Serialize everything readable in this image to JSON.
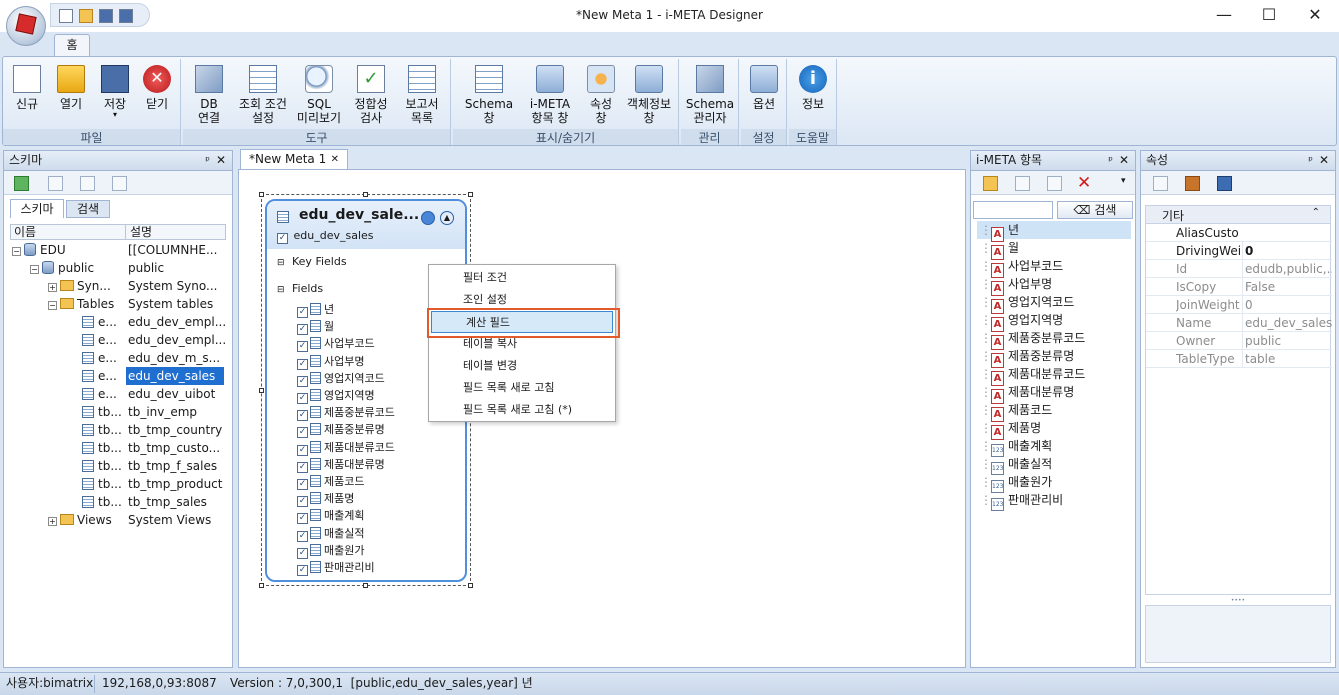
{
  "window": {
    "title": "*New Meta 1 - i-META Designer",
    "minimize": "—",
    "maximize": "☐",
    "close": "✕"
  },
  "ribbon": {
    "tab": "홈",
    "groups": [
      {
        "label": "파일",
        "buttons": [
          {
            "label": "신규",
            "icon": "new-doc-icon"
          },
          {
            "label": "열기",
            "icon": "open-folder-icon"
          },
          {
            "label": "저장",
            "icon": "save-icon",
            "sub": "▾"
          },
          {
            "label": "닫기",
            "icon": "close-doc-icon"
          }
        ]
      },
      {
        "label": "도구",
        "buttons": [
          {
            "label": "DB\n연결",
            "icon": "db-connect-icon"
          },
          {
            "label": "조회 조건\n설정",
            "icon": "filter-icon"
          },
          {
            "label": "SQL\n미리보기",
            "icon": "sql-preview-icon"
          },
          {
            "label": "정합성\n검사",
            "icon": "validate-icon"
          },
          {
            "label": "보고서\n목록",
            "icon": "report-list-icon"
          }
        ]
      },
      {
        "label": "표시/숨기기",
        "buttons": [
          {
            "label": "Schema\n창",
            "icon": "schema-window-icon"
          },
          {
            "label": "i-META\n항목 창",
            "icon": "imeta-window-icon"
          },
          {
            "label": "속성\n창",
            "icon": "property-window-icon"
          },
          {
            "label": "객체정보\n창",
            "icon": "object-info-icon"
          }
        ]
      },
      {
        "label": "관리",
        "buttons": [
          {
            "label": "Schema\n관리자",
            "icon": "schema-manager-icon"
          }
        ]
      },
      {
        "label": "설정",
        "buttons": [
          {
            "label": "옵션",
            "icon": "options-icon"
          }
        ]
      },
      {
        "label": "도움말",
        "buttons": [
          {
            "label": "정보",
            "icon": "info-icon"
          }
        ]
      }
    ]
  },
  "schema_panel": {
    "title": "스키마",
    "pin": "ᵖ",
    "close": "✕",
    "tabs": [
      "스키마",
      "검색"
    ],
    "columns": [
      "이름",
      "설명"
    ],
    "rows": [
      {
        "name": "EDU",
        "desc": "[[COLUMNHE..."
      },
      {
        "name": "public",
        "desc": "public"
      },
      {
        "name": "Syn...",
        "desc": "System Syno..."
      },
      {
        "name": "Tables",
        "desc": "System tables"
      },
      {
        "name": "e...",
        "desc": "edu_dev_empl..."
      },
      {
        "name": "e...",
        "desc": "edu_dev_empl..."
      },
      {
        "name": "e...",
        "desc": "edu_dev_m_s..."
      },
      {
        "name": "e...",
        "desc": "edu_dev_sales"
      },
      {
        "name": "e...",
        "desc": "edu_dev_uibot"
      },
      {
        "name": "tb...",
        "desc": "tb_inv_emp"
      },
      {
        "name": "tb...",
        "desc": "tb_tmp_country"
      },
      {
        "name": "tb...",
        "desc": "tb_tmp_custo..."
      },
      {
        "name": "tb...",
        "desc": "tb_tmp_f_sales"
      },
      {
        "name": "tb...",
        "desc": "tb_tmp_product"
      },
      {
        "name": "tb...",
        "desc": "tb_tmp_sales"
      },
      {
        "name": "Views",
        "desc": "System Views"
      }
    ]
  },
  "document": {
    "tab": "*New Meta 1",
    "tab_close": "✕",
    "entity": {
      "title": "edu_dev_sale...",
      "table_name": "edu_dev_sales",
      "key_fields_label": "Key Fields",
      "fields_label": "Fields",
      "fields": [
        "년",
        "월",
        "사업부코드",
        "사업부명",
        "영업지역코드",
        "영업지역명",
        "제품중분류코드",
        "제품중분류명",
        "제품대분류코드",
        "제품대분류명",
        "제품코드",
        "제품명",
        "매출계획",
        "매출실적",
        "매출원가",
        "판매관리비"
      ]
    },
    "context_menu": [
      "필터 조건",
      "조인 설정",
      "계산 필드",
      "테이블 복사",
      "테이블 변경",
      "필드 목록 새로 고침",
      "필드 목록 새로 고침 (*)"
    ]
  },
  "items_panel": {
    "title": "i-META 항목",
    "pin": "ᵖ",
    "close": "✕",
    "search_button": "검색",
    "search_value": "",
    "items": [
      {
        "label": "년",
        "type": "text"
      },
      {
        "label": "월",
        "type": "text"
      },
      {
        "label": "사업부코드",
        "type": "text"
      },
      {
        "label": "사업부명",
        "type": "text"
      },
      {
        "label": "영업지역코드",
        "type": "text"
      },
      {
        "label": "영업지역명",
        "type": "text"
      },
      {
        "label": "제품중분류코드",
        "type": "text"
      },
      {
        "label": "제품중분류명",
        "type": "text"
      },
      {
        "label": "제품대분류코드",
        "type": "text"
      },
      {
        "label": "제품대분류명",
        "type": "text"
      },
      {
        "label": "제품코드",
        "type": "text"
      },
      {
        "label": "제품명",
        "type": "text"
      },
      {
        "label": "매출계획",
        "type": "number"
      },
      {
        "label": "매출실적",
        "type": "number"
      },
      {
        "label": "매출원가",
        "type": "number"
      },
      {
        "label": "판매관리비",
        "type": "number"
      }
    ]
  },
  "props_panel": {
    "title": "속성",
    "pin": "ᵖ",
    "close": "✕",
    "category": "기타",
    "rows": [
      {
        "key": "AliasCusto",
        "value": ""
      },
      {
        "key": "DrivingWeig",
        "value": "0"
      },
      {
        "key": "Id",
        "value": "edudb,public,..."
      },
      {
        "key": "IsCopy",
        "value": "False"
      },
      {
        "key": "JoinWeight",
        "value": "0"
      },
      {
        "key": "Name",
        "value": "edu_dev_sales"
      },
      {
        "key": "Owner",
        "value": "public"
      },
      {
        "key": "TableType",
        "value": "table"
      }
    ]
  },
  "statusbar": {
    "user": "사용자:bimatrix",
    "server": "192,168,0,93:8087",
    "version": "Version : 7,0,300,1  [public,edu_dev_sales,year] 년"
  },
  "colors": {
    "accent": "#1f6fd1",
    "selection": "#cfe3f7",
    "menu_highlight": "#d6e9f8",
    "menu_border": "#e05a2b"
  }
}
